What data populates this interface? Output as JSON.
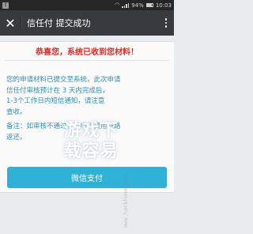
{
  "status_bar": {
    "warning_badge": "!",
    "battery_percent": "94%",
    "time": "10:03"
  },
  "titlebar": {
    "close_glyph": "✕",
    "title": "信任付 提交成功"
  },
  "content": {
    "heading": "恭喜您，系统已收到您材料！",
    "body_line_1": "您的申请材料已提交至系统，此次申请",
    "body_line_2": "信任付审核预计在 3 天内完成后，",
    "body_line_3": "1-3个工作日内短信通知，请注意",
    "body_line_4": "查收。",
    "note_line_1": "备注：如审核不通过，可申请费用原路",
    "note_line_2": "返还。"
  },
  "pay_button": {
    "label": "微信支付"
  },
  "watermark": {
    "line_1": "游戏下",
    "line_2": "载容易",
    "url": "www.hackhome.com"
  },
  "colors": {
    "titlebar_bg": "#393a3f",
    "heading_red": "#e02b22",
    "body_blue": "#2f8fb0",
    "button_blue": "#2fb2d6"
  }
}
